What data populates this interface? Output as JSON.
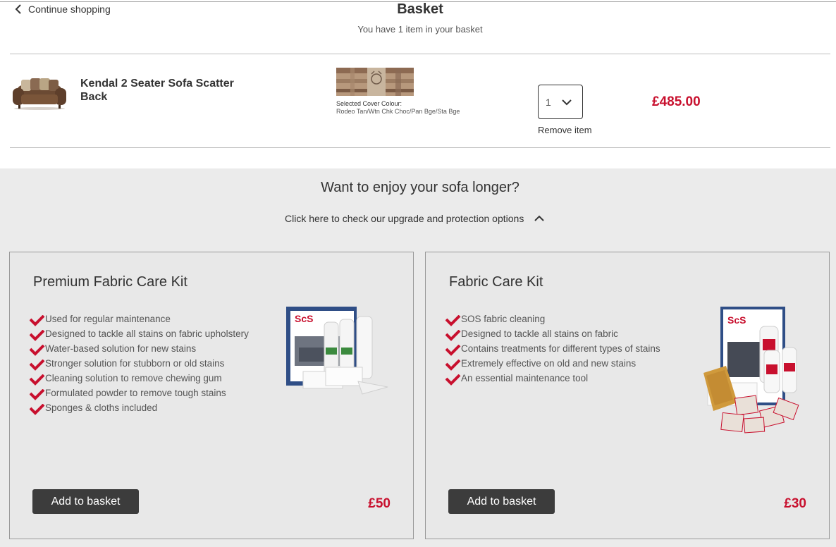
{
  "header": {
    "continue_label": "Continue shopping",
    "title": "Basket",
    "subtitle": "You have 1 item in your basket"
  },
  "item": {
    "name": "Kendal 2 Seater Sofa Scatter Back",
    "cover_label": "Selected Cover Colour:",
    "cover_value": "Rodeo Tan/Wtn Chk Choc/Pan Bge/Sta Bge",
    "quantity": "1",
    "remove_label": "Remove item",
    "price": "£485.00"
  },
  "upsell": {
    "title": "Want to enjoy your sofa longer?",
    "toggle_label": "Click here to check our upgrade and protection options",
    "cards": [
      {
        "title": "Premium Fabric Care Kit",
        "features": [
          "Used for regular maintenance",
          "Designed to tackle all stains on fabric upholstery",
          "Water-based solution for new stains",
          "Stronger solution for stubborn or old stains",
          "Cleaning solution to remove chewing gum",
          "Formulated powder to remove tough stains",
          "Sponges & cloths included"
        ],
        "button_label": "Add to basket",
        "price": "£50"
      },
      {
        "title": "Fabric Care Kit",
        "features": [
          "SOS fabric cleaning",
          "Designed to tackle all stains on fabric",
          "Contains treatments for different types of stains",
          "Extremely effective on old and new stains",
          "An essential maintenance tool"
        ],
        "button_label": "Add to basket",
        "price": "£30"
      }
    ]
  },
  "colors": {
    "accent_price": "#c8102e",
    "button_bg": "#3c3c3c",
    "panel_bg": "#ebebeb"
  },
  "icons": {
    "back": "chevron-left-icon",
    "dropdown": "chevron-down-icon",
    "toggle": "chevron-up-icon",
    "feature": "check-icon"
  }
}
